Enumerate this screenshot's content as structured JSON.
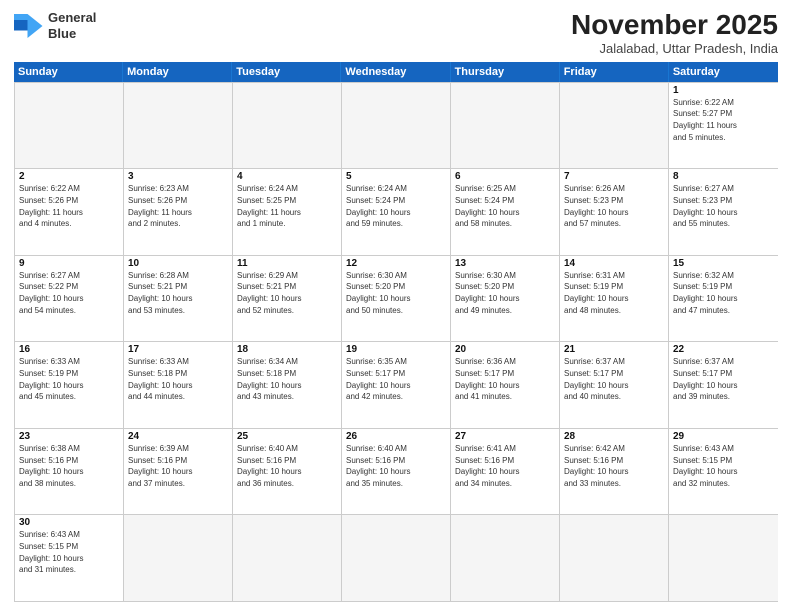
{
  "header": {
    "logo_line1": "General",
    "logo_line2": "Blue",
    "month_title": "November 2025",
    "subtitle": "Jalalabad, Uttar Pradesh, India"
  },
  "days_of_week": [
    "Sunday",
    "Monday",
    "Tuesday",
    "Wednesday",
    "Thursday",
    "Friday",
    "Saturday"
  ],
  "weeks": [
    [
      {
        "day": "",
        "empty": true
      },
      {
        "day": "",
        "empty": true
      },
      {
        "day": "",
        "empty": true
      },
      {
        "day": "",
        "empty": true
      },
      {
        "day": "",
        "empty": true
      },
      {
        "day": "",
        "empty": true
      },
      {
        "day": "1",
        "detail": "Sunrise: 6:22 AM\nSunset: 5:27 PM\nDaylight: 11 hours\nand 5 minutes."
      }
    ],
    [
      {
        "day": "2",
        "detail": "Sunrise: 6:22 AM\nSunset: 5:26 PM\nDaylight: 11 hours\nand 4 minutes."
      },
      {
        "day": "3",
        "detail": "Sunrise: 6:23 AM\nSunset: 5:26 PM\nDaylight: 11 hours\nand 2 minutes."
      },
      {
        "day": "4",
        "detail": "Sunrise: 6:24 AM\nSunset: 5:25 PM\nDaylight: 11 hours\nand 1 minute."
      },
      {
        "day": "5",
        "detail": "Sunrise: 6:24 AM\nSunset: 5:24 PM\nDaylight: 10 hours\nand 59 minutes."
      },
      {
        "day": "6",
        "detail": "Sunrise: 6:25 AM\nSunset: 5:24 PM\nDaylight: 10 hours\nand 58 minutes."
      },
      {
        "day": "7",
        "detail": "Sunrise: 6:26 AM\nSunset: 5:23 PM\nDaylight: 10 hours\nand 57 minutes."
      },
      {
        "day": "8",
        "detail": "Sunrise: 6:27 AM\nSunset: 5:23 PM\nDaylight: 10 hours\nand 55 minutes."
      }
    ],
    [
      {
        "day": "9",
        "detail": "Sunrise: 6:27 AM\nSunset: 5:22 PM\nDaylight: 10 hours\nand 54 minutes."
      },
      {
        "day": "10",
        "detail": "Sunrise: 6:28 AM\nSunset: 5:21 PM\nDaylight: 10 hours\nand 53 minutes."
      },
      {
        "day": "11",
        "detail": "Sunrise: 6:29 AM\nSunset: 5:21 PM\nDaylight: 10 hours\nand 52 minutes."
      },
      {
        "day": "12",
        "detail": "Sunrise: 6:30 AM\nSunset: 5:20 PM\nDaylight: 10 hours\nand 50 minutes."
      },
      {
        "day": "13",
        "detail": "Sunrise: 6:30 AM\nSunset: 5:20 PM\nDaylight: 10 hours\nand 49 minutes."
      },
      {
        "day": "14",
        "detail": "Sunrise: 6:31 AM\nSunset: 5:19 PM\nDaylight: 10 hours\nand 48 minutes."
      },
      {
        "day": "15",
        "detail": "Sunrise: 6:32 AM\nSunset: 5:19 PM\nDaylight: 10 hours\nand 47 minutes."
      }
    ],
    [
      {
        "day": "16",
        "detail": "Sunrise: 6:33 AM\nSunset: 5:19 PM\nDaylight: 10 hours\nand 45 minutes."
      },
      {
        "day": "17",
        "detail": "Sunrise: 6:33 AM\nSunset: 5:18 PM\nDaylight: 10 hours\nand 44 minutes."
      },
      {
        "day": "18",
        "detail": "Sunrise: 6:34 AM\nSunset: 5:18 PM\nDaylight: 10 hours\nand 43 minutes."
      },
      {
        "day": "19",
        "detail": "Sunrise: 6:35 AM\nSunset: 5:17 PM\nDaylight: 10 hours\nand 42 minutes."
      },
      {
        "day": "20",
        "detail": "Sunrise: 6:36 AM\nSunset: 5:17 PM\nDaylight: 10 hours\nand 41 minutes."
      },
      {
        "day": "21",
        "detail": "Sunrise: 6:37 AM\nSunset: 5:17 PM\nDaylight: 10 hours\nand 40 minutes."
      },
      {
        "day": "22",
        "detail": "Sunrise: 6:37 AM\nSunset: 5:17 PM\nDaylight: 10 hours\nand 39 minutes."
      }
    ],
    [
      {
        "day": "23",
        "detail": "Sunrise: 6:38 AM\nSunset: 5:16 PM\nDaylight: 10 hours\nand 38 minutes."
      },
      {
        "day": "24",
        "detail": "Sunrise: 6:39 AM\nSunset: 5:16 PM\nDaylight: 10 hours\nand 37 minutes."
      },
      {
        "day": "25",
        "detail": "Sunrise: 6:40 AM\nSunset: 5:16 PM\nDaylight: 10 hours\nand 36 minutes."
      },
      {
        "day": "26",
        "detail": "Sunrise: 6:40 AM\nSunset: 5:16 PM\nDaylight: 10 hours\nand 35 minutes."
      },
      {
        "day": "27",
        "detail": "Sunrise: 6:41 AM\nSunset: 5:16 PM\nDaylight: 10 hours\nand 34 minutes."
      },
      {
        "day": "28",
        "detail": "Sunrise: 6:42 AM\nSunset: 5:16 PM\nDaylight: 10 hours\nand 33 minutes."
      },
      {
        "day": "29",
        "detail": "Sunrise: 6:43 AM\nSunset: 5:15 PM\nDaylight: 10 hours\nand 32 minutes."
      }
    ],
    [
      {
        "day": "30",
        "detail": "Sunrise: 6:43 AM\nSunset: 5:15 PM\nDaylight: 10 hours\nand 31 minutes."
      },
      {
        "day": "",
        "empty": true
      },
      {
        "day": "",
        "empty": true
      },
      {
        "day": "",
        "empty": true
      },
      {
        "day": "",
        "empty": true
      },
      {
        "day": "",
        "empty": true
      },
      {
        "day": "",
        "empty": true
      }
    ]
  ]
}
